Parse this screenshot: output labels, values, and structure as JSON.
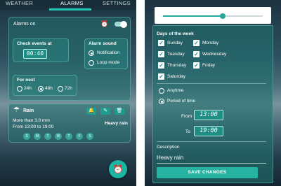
{
  "tabs": [
    "WEATHER",
    "ALARMS",
    "SETTINGS"
  ],
  "alarm": {
    "title": "Alarms on",
    "check_events_label": "Check events at",
    "check_time": "00:40",
    "sound_label": "Alarm sound",
    "sound_options": [
      "Notification",
      "Loop mode"
    ],
    "for_next_label": "For next",
    "for_next_options": [
      "24h",
      "48h",
      "72h"
    ]
  },
  "rain": {
    "title": "Rain",
    "amount": "More than 3.0 mm",
    "time_range": "From 13:00 to 19:00",
    "condition": "Heavy rain",
    "days": [
      "S",
      "M",
      "T",
      "W",
      "T",
      "F",
      "S"
    ]
  },
  "edit": {
    "header": "Days of the week",
    "days": [
      "Sunday",
      "Monday",
      "Tuesday",
      "Wednesday",
      "Thursday",
      "Friday",
      "Saturday"
    ],
    "time_options": [
      "Anytime",
      "Period of time"
    ],
    "from_label": "From",
    "from_time": "13:00",
    "to_label": "To",
    "to_time": "19:00",
    "description_label": "Description",
    "description_value": "Heavy rain",
    "save_label": "SAVE CHANGES",
    "slider_level": 0.6
  },
  "colors": {
    "accent": "#1ab6a4"
  }
}
